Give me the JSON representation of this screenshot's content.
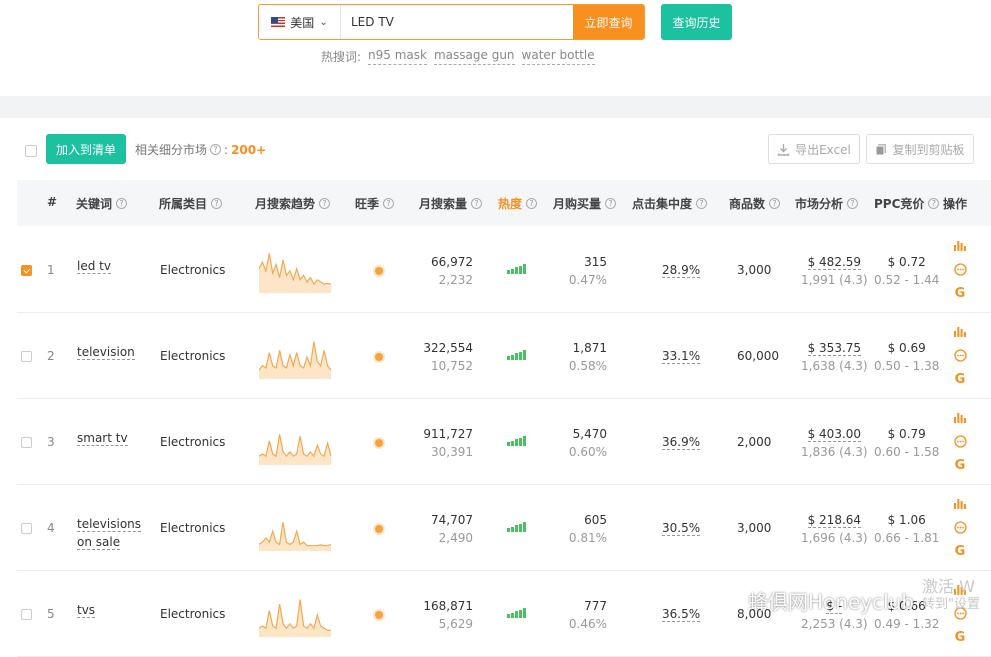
{
  "search": {
    "country": "美国",
    "query": "LED TV",
    "submit_label": "立即查询",
    "history_label": "查询历史",
    "hot_label": "热搜词:",
    "hot_terms": [
      "n95 mask",
      "massage gun",
      "water bottle"
    ]
  },
  "toolbar": {
    "add_label": "加入到清单",
    "related_label": "相关细分市场",
    "related_sep": ":",
    "related_count": "200+",
    "export_label": "导出Excel",
    "copy_label": "复制到剪贴板"
  },
  "columns": {
    "index": "#",
    "keyword": "关键词",
    "category": "所属类目",
    "trend": "月搜索趋势",
    "season": "旺季",
    "volume": "月搜索量",
    "heat": "热度",
    "sales": "月购买量",
    "click": "点击集中度",
    "products": "商品数",
    "market": "市场分析",
    "ppc": "PPC竞价",
    "actions": "操作"
  },
  "rows": [
    {
      "index": "1",
      "keyword": "led tv",
      "category": "Electronics",
      "checked": true,
      "trend": [
        0.55,
        0.7,
        0.5,
        0.9,
        0.45,
        0.65,
        0.35,
        0.75,
        0.4,
        0.5,
        0.3,
        0.55,
        0.3,
        0.4,
        0.25,
        0.35,
        0.2,
        0.3,
        0.25,
        0.2,
        0.22,
        0.2
      ],
      "volume": "66,972",
      "volume_sub": "2,232",
      "heat": 5,
      "sales": "315",
      "sales_sub": "0.47%",
      "click": "28.9%",
      "products": "3,000",
      "market": "$ 482.59",
      "market_sub": "1,991 (4.3)",
      "ppc": "$ 0.72",
      "ppc_range": "0.52 - 1.44"
    },
    {
      "index": "2",
      "keyword": "television",
      "category": "Electronics",
      "checked": false,
      "trend": [
        0.2,
        0.3,
        0.25,
        0.6,
        0.3,
        0.25,
        0.65,
        0.3,
        0.25,
        0.55,
        0.3,
        0.6,
        0.3,
        0.25,
        0.5,
        0.3,
        0.85,
        0.4,
        0.3,
        0.65,
        0.3,
        0.2
      ],
      "volume": "322,554",
      "volume_sub": "10,752",
      "heat": 5,
      "sales": "1,871",
      "sales_sub": "0.58%",
      "click": "33.1%",
      "products": "60,000",
      "market": "$ 353.75",
      "market_sub": "1,638 (4.3)",
      "ppc": "$ 0.69",
      "ppc_range": "0.50 - 1.38"
    },
    {
      "index": "3",
      "keyword": "smart tv",
      "category": "Electronics",
      "checked": false,
      "trend": [
        0.2,
        0.25,
        0.2,
        0.55,
        0.25,
        0.2,
        0.7,
        0.3,
        0.2,
        0.3,
        0.2,
        0.25,
        0.65,
        0.25,
        0.2,
        0.3,
        0.2,
        0.45,
        0.25,
        0.2,
        0.5,
        0.2
      ],
      "volume": "911,727",
      "volume_sub": "30,391",
      "heat": 5,
      "sales": "5,470",
      "sales_sub": "0.60%",
      "click": "36.9%",
      "products": "2,000",
      "market": "$ 403.00",
      "market_sub": "1,836 (4.3)",
      "ppc": "$ 0.79",
      "ppc_range": "0.60 - 1.58"
    },
    {
      "index": "4",
      "keyword": "televisions on sale",
      "category": "Electronics",
      "checked": false,
      "trend": [
        0.15,
        0.2,
        0.3,
        0.2,
        0.45,
        0.2,
        0.15,
        0.65,
        0.2,
        0.15,
        0.2,
        0.45,
        0.15,
        0.2,
        0.12,
        0.12,
        0.12,
        0.12,
        0.14,
        0.12,
        0.12,
        0.15
      ],
      "volume": "74,707",
      "volume_sub": "2,490",
      "heat": 5,
      "sales": "605",
      "sales_sub": "0.81%",
      "click": "30.5%",
      "products": "3,000",
      "market": "$ 218.64",
      "market_sub": "1,696 (4.3)",
      "ppc": "$ 1.06",
      "ppc_range": "0.66 - 1.81"
    },
    {
      "index": "5",
      "keyword": "tvs",
      "category": "Electronics",
      "checked": false,
      "trend": [
        0.2,
        0.25,
        0.2,
        0.6,
        0.25,
        0.2,
        0.75,
        0.3,
        0.2,
        0.3,
        0.2,
        0.25,
        0.85,
        0.25,
        0.2,
        0.3,
        0.2,
        0.5,
        0.25,
        0.2,
        0.15,
        0.15
      ],
      "volume": "168,871",
      "volume_sub": "5,629",
      "heat": 5,
      "sales": "777",
      "sales_sub": "0.46%",
      "click": "36.5%",
      "products": "8,000",
      "market": "$ -",
      "market_sub": "2,253 (4.3)",
      "ppc": "$ 0.66",
      "ppc_range": "0.49 - 1.32"
    }
  ],
  "watermark": {
    "text": "蜂俱网Honeyclub",
    "activate_1": "激活 W",
    "activate_2": "转到\"设置"
  },
  "colors": {
    "accent": "#f7901e",
    "teal": "#1cc1a0",
    "heat_bar": "#46c35d",
    "trend_fill": "#fde6c8",
    "trend_line": "#f4a84e"
  }
}
